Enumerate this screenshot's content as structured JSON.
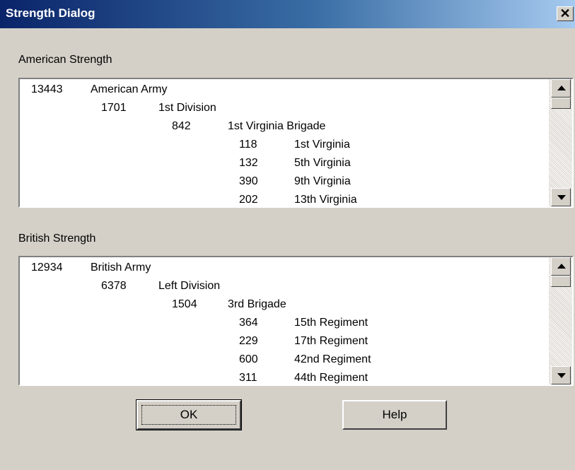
{
  "window": {
    "title": "Strength Dialog",
    "close_symbol": "✕"
  },
  "american": {
    "label": "American Strength",
    "rows": [
      {
        "num": "13443",
        "name": "American Army",
        "level": 0
      },
      {
        "num": "1701",
        "name": "1st Division",
        "level": 1
      },
      {
        "num": "842",
        "name": "1st Virginia Brigade",
        "level": 2
      },
      {
        "num": "118",
        "name": "1st Virginia",
        "level": 3
      },
      {
        "num": "132",
        "name": "5th Virginia",
        "level": 3
      },
      {
        "num": "390",
        "name": "9th Virginia",
        "level": 3
      },
      {
        "num": "202",
        "name": "13th Virginia",
        "level": 3
      }
    ]
  },
  "british": {
    "label": "British Strength",
    "rows": [
      {
        "num": "12934",
        "name": "British Army",
        "level": 0
      },
      {
        "num": "6378",
        "name": "Left Division",
        "level": 1
      },
      {
        "num": "1504",
        "name": "3rd Brigade",
        "level": 2
      },
      {
        "num": "364",
        "name": "15th Regiment",
        "level": 3
      },
      {
        "num": "229",
        "name": "17th Regiment",
        "level": 3
      },
      {
        "num": "600",
        "name": "42nd Regiment",
        "level": 3
      },
      {
        "num": "311",
        "name": "44th Regiment",
        "level": 3
      }
    ]
  },
  "buttons": {
    "ok": "OK",
    "help": "Help"
  }
}
